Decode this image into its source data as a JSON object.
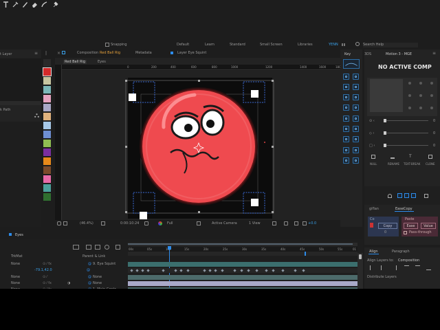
{
  "toolbar": {
    "snapping": "Snapping",
    "workspaces": [
      "Default",
      "Learn",
      "Standard",
      "Small Screen",
      "Libraries",
      "YENN"
    ],
    "search": "Search Help"
  },
  "left_panel": {
    "tab": "t Layer",
    "path_tab": "k Path"
  },
  "comp_panel": {
    "tab_prefix": "Composition",
    "comp_name": "Red Ball Rig",
    "metadata_tab": "Metadata",
    "layer_tab": "Layer  Eye Squint",
    "breadcrumb_1": "Red Ball Rig",
    "breadcrumb_2": "Eyes",
    "ruler_ticks": [
      "0",
      "200",
      "400",
      "600",
      "800",
      "1000",
      "1200",
      "1400",
      "1600",
      "1800"
    ],
    "footer": {
      "zoom": "(46.4%)",
      "timecode": "0:00:10:24",
      "quality": "Full",
      "camera": "Active Camera",
      "views": "1 View",
      "exposure": "+0.0"
    }
  },
  "key_panel": {
    "tab": "Key",
    "tab2": "3DS"
  },
  "motion_panel": {
    "tab": "Motion 3 - MGE",
    "status": "NO ACTIVE COMP",
    "slider_values": [
      "0",
      "0",
      "0"
    ],
    "actions": [
      "NULL",
      "RENAME",
      "TEXT-BREAK",
      "CLONE"
    ]
  },
  "ease_panel": {
    "tabs": [
      "giflan",
      "EaseCopy"
    ],
    "copy_label": "Co",
    "copy_button": "Copy",
    "paste_label": "Paste",
    "ease_button": "Ease",
    "value_button": "Value",
    "count": "0",
    "pass_through": "Pass-through"
  },
  "align_panel": {
    "tabs": [
      "Align",
      "Paragraph"
    ],
    "align_to_label": "Align Layers to:",
    "align_to_value": "Composition",
    "distribute": "Distribute Layers"
  },
  "timeline": {
    "tab": "Eyes",
    "columns": [
      "TrkMat",
      "Parent & Link"
    ],
    "ruler": [
      "00s",
      "05s",
      "10s",
      "15s",
      "20s",
      "25s",
      "30s",
      "35s",
      "40s",
      "45s",
      "50s",
      "55s",
      "01"
    ],
    "rows": [
      {
        "trkmat": "None",
        "parent": "9. Eye Squint"
      },
      {
        "trkmat": "",
        "parent": ""
      },
      {
        "trkmat": "None",
        "parent": "None"
      },
      {
        "trkmat": "None",
        "parent": "None"
      },
      {
        "trkmat": "None",
        "parent": "1. Main Contr"
      }
    ],
    "value": "-79.1,42.0"
  },
  "colors": {
    "accent": "#2d8ceb",
    "ball": "#ef4a4f",
    "swatch_highlight": "#d42a2a"
  }
}
